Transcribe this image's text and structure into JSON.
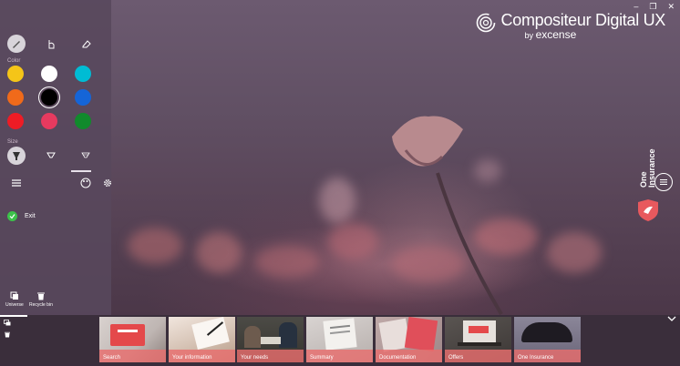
{
  "window": {
    "controls": [
      "–",
      "❐",
      "✕"
    ]
  },
  "brand": {
    "title": "Compositeur Digital UX",
    "by": "by",
    "company": "excense",
    "logo_icon": "concentric-ring-logo"
  },
  "tools_panel": {
    "pen_tools": [
      {
        "name": "pen",
        "active": true
      },
      {
        "name": "hand-touch",
        "active": false
      },
      {
        "name": "eraser",
        "active": false
      }
    ],
    "color_label": "Color",
    "colors": [
      "#f5c518",
      "#ffffff",
      "#00bcd4",
      "#f06a1a",
      "#000000",
      "#1565d8",
      "#ee1c25",
      "#e63a5f",
      "#118a2c"
    ],
    "selected_color": "#000000",
    "size_label": "Size",
    "sizes": [
      "large",
      "medium",
      "small"
    ],
    "settings_icons": [
      "menu-icon",
      "palette-icon",
      "gear-icon"
    ],
    "exit_label": "Exit",
    "bottom_tools": [
      {
        "label": "Universe",
        "icon": "universe-icon"
      },
      {
        "label": "Recycle bin",
        "icon": "trash-icon"
      }
    ]
  },
  "side_panel": {
    "title_line1": "One",
    "title_line2": "Insurance",
    "accent": "#e8595e"
  },
  "thumbnails": [
    {
      "label": "Search"
    },
    {
      "label": "Your information"
    },
    {
      "label": "Your needs"
    },
    {
      "label": "Summary"
    },
    {
      "label": "Documentation"
    },
    {
      "label": "Offers"
    },
    {
      "label": "One Insurance"
    }
  ]
}
